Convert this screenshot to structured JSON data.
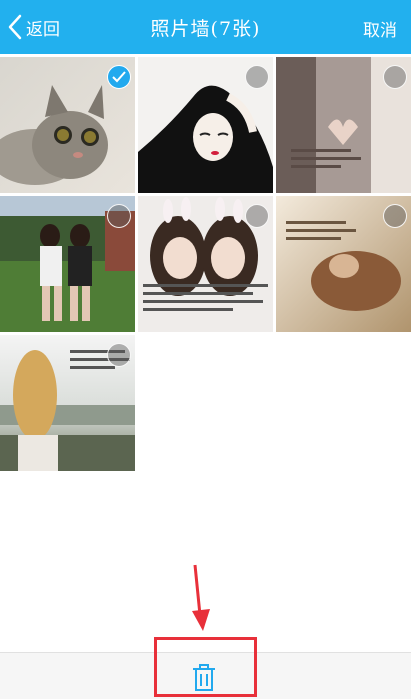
{
  "header": {
    "back_label": "返回",
    "title": "照片墙(7张)",
    "cancel_label": "取消",
    "background": "#22b0ee"
  },
  "photos": [
    {
      "name": "photo-cat",
      "selected": true
    },
    {
      "name": "photo-girl-sketch",
      "selected": false
    },
    {
      "name": "photo-heart-hands",
      "selected": false
    },
    {
      "name": "photo-two-girls-field",
      "selected": false
    },
    {
      "name": "photo-two-girls-bunny-ears",
      "selected": false
    },
    {
      "name": "photo-lying-girl",
      "selected": false
    },
    {
      "name": "photo-girl-blonde-back",
      "selected": false
    }
  ],
  "bottom_bar": {
    "action_icon": "trash-icon"
  },
  "colors": {
    "accent": "#22b0ee",
    "annotation": "#e8303a"
  }
}
